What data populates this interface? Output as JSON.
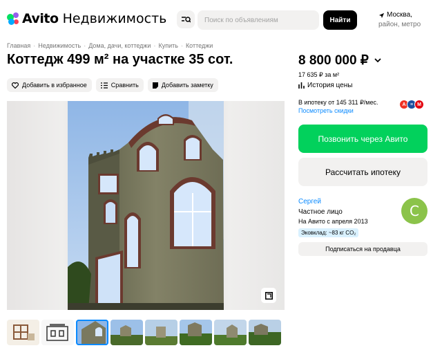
{
  "header": {
    "logo_text": "Avito",
    "section": "Недвижимость",
    "search_placeholder": "Поиск по объявлениям",
    "search_button": "Найти",
    "location_city": "Москва,",
    "location_hint": "район, метро"
  },
  "breadcrumbs": [
    "Главная",
    "Недвижимость",
    "Дома, дачи, коттеджи",
    "Купить",
    "Коттеджи"
  ],
  "listing": {
    "title": "Коттедж 499 м² на участке 35 сот.",
    "actions": {
      "favorite": "Добавить в избранное",
      "compare": "Сравнить",
      "note": "Добавить заметку"
    },
    "photo_count": 8,
    "active_photo": 3
  },
  "price": {
    "value": "8 800 000 ₽",
    "per_meter": "17 635 ₽ за м²",
    "history": "История цены",
    "mortgage": "В ипотеку от 145 311 ₽/мес.",
    "discounts": "Посмотреть скидки",
    "bank_colors": [
      "#ef3124",
      "#1d4fa0",
      "#e30611"
    ]
  },
  "contact": {
    "call": "Позвонить через Авито",
    "calculate": "Рассчитать ипотеку"
  },
  "seller": {
    "name": "Сергей",
    "type": "Частное лицо",
    "since": "На Авито с апреля 2013",
    "eco": "Эковклад: ~83 кг CO₂",
    "avatar_letter": "С",
    "avatar_color": "#8bc34a",
    "subscribe": "Подписаться на продавца"
  }
}
